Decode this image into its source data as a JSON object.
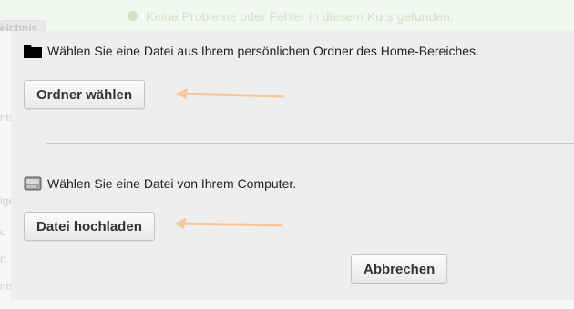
{
  "background": {
    "notice_text": "Keine Probleme oder Fehler in diesem Kurs gefunden.",
    "tab_label": "eichnis",
    "side_fragments": [
      "nis",
      "igen",
      "u",
      "rt",
      "nis"
    ]
  },
  "dialog": {
    "folder_section": {
      "icon": "folder-icon",
      "text": "Wählen Sie eine Datei aus Ihrem persönlichen Ordner des Home-Bereiches.",
      "button_label": "Ordner wählen"
    },
    "computer_section": {
      "icon": "drive-icon",
      "text": "Wählen Sie eine Datei von Ihrem Computer.",
      "button_label": "Datei hochladen"
    },
    "cancel_label": "Abbrechen"
  },
  "annotation": {
    "arrow_color": "#f7c79b"
  }
}
